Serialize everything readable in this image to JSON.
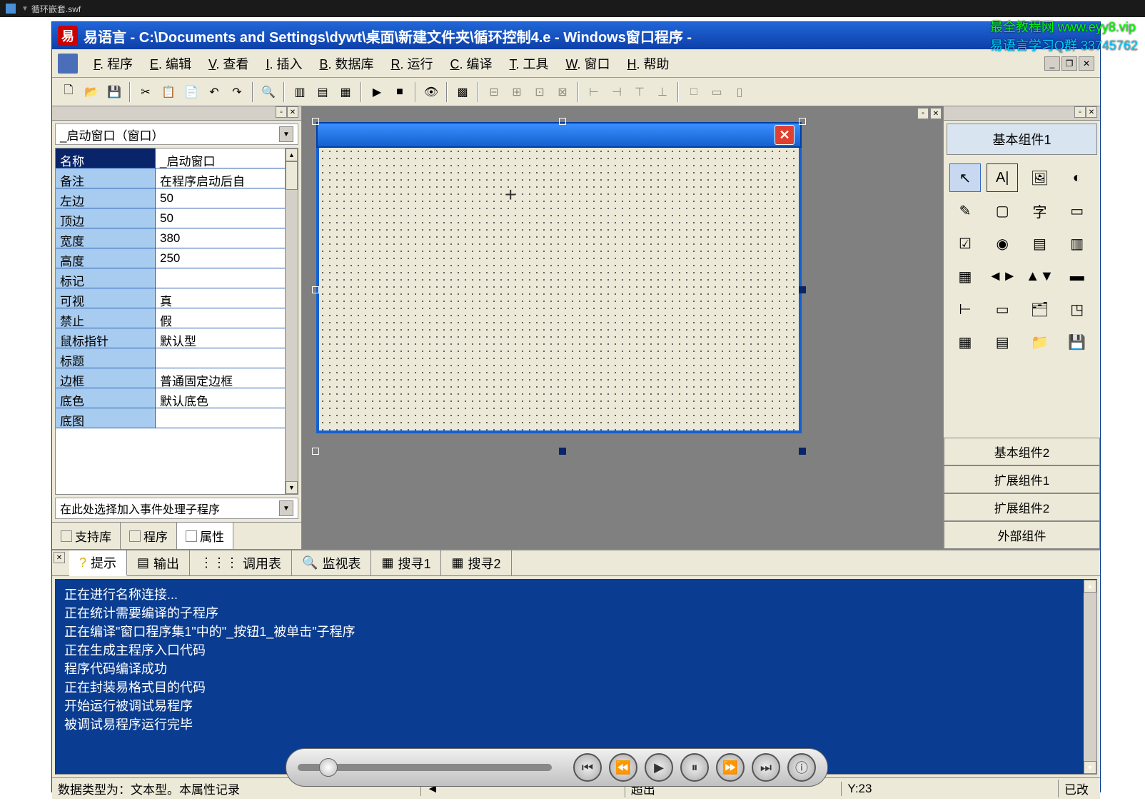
{
  "top_bar": {
    "file_label": "循环嵌套.swf"
  },
  "watermark": {
    "line1": "最全教程网 www.eyy8.vip",
    "line2": "易语言学习Q群 33745762"
  },
  "title": "易语言 - C:\\Documents and Settings\\dywt\\桌面\\新建文件夹\\循环控制4.e - Windows窗口程序 -",
  "menu": [
    {
      "key": "F",
      "label": ". 程序"
    },
    {
      "key": "E",
      "label": ". 编辑"
    },
    {
      "key": "V",
      "label": ". 查看"
    },
    {
      "key": "I",
      "label": ". 插入"
    },
    {
      "key": "B",
      "label": ". 数据库"
    },
    {
      "key": "R",
      "label": ". 运行"
    },
    {
      "key": "C",
      "label": ". 编译"
    },
    {
      "key": "T",
      "label": ". 工具"
    },
    {
      "key": "W",
      "label": ". 窗口"
    },
    {
      "key": "H",
      "label": ". 帮助"
    }
  ],
  "left_panel": {
    "object_selector": "_启动窗口（窗口）",
    "props": [
      {
        "name": "名称",
        "value": "_启动窗口",
        "selected": true
      },
      {
        "name": "备注",
        "value": "在程序启动后自"
      },
      {
        "name": "左边",
        "value": "50"
      },
      {
        "name": "顶边",
        "value": "50"
      },
      {
        "name": "宽度",
        "value": "380"
      },
      {
        "name": "高度",
        "value": "250"
      },
      {
        "name": "标记",
        "value": ""
      },
      {
        "name": "可视",
        "value": "真"
      },
      {
        "name": "禁止",
        "value": "假"
      },
      {
        "name": "鼠标指针",
        "value": "默认型"
      },
      {
        "name": "标题",
        "value": ""
      },
      {
        "name": "边框",
        "value": "普通固定边框"
      },
      {
        "name": "底色",
        "value": "默认底色"
      },
      {
        "name": "底图",
        "value": ""
      }
    ],
    "event_selector": "在此处选择加入事件处理子程序",
    "tabs": [
      {
        "label": "支持库"
      },
      {
        "label": "程序"
      },
      {
        "label": "属性",
        "active": true
      }
    ]
  },
  "right_panel": {
    "header": "基本组件1",
    "tabs": [
      "基本组件2",
      "扩展组件1",
      "扩展组件2",
      "外部组件"
    ]
  },
  "bottom_panel": {
    "tabs": [
      {
        "icon": "?",
        "label": "提示",
        "active": true
      },
      {
        "icon": "▤",
        "label": "输出"
      },
      {
        "icon": "⋮⋮⋮",
        "label": "调用表"
      },
      {
        "icon": "🔍",
        "label": "监视表"
      },
      {
        "icon": "▦",
        "label": "搜寻1"
      },
      {
        "icon": "▦",
        "label": "搜寻2"
      }
    ],
    "output": [
      "正在进行名称连接...",
      "正在统计需要编译的子程序",
      "正在编译\"窗口程序集1\"中的\"_按钮1_被单击\"子程序",
      "正在生成主程序入口代码",
      "程序代码编译成功",
      "正在封装易格式目的代码",
      "开始运行被调试易程序",
      "被调试易程序运行完毕"
    ]
  },
  "status_bar": {
    "main": "数据类型为：文本型。本属性记录",
    "overflow": "超出",
    "pos": "Y:23",
    "modified": "已改"
  }
}
